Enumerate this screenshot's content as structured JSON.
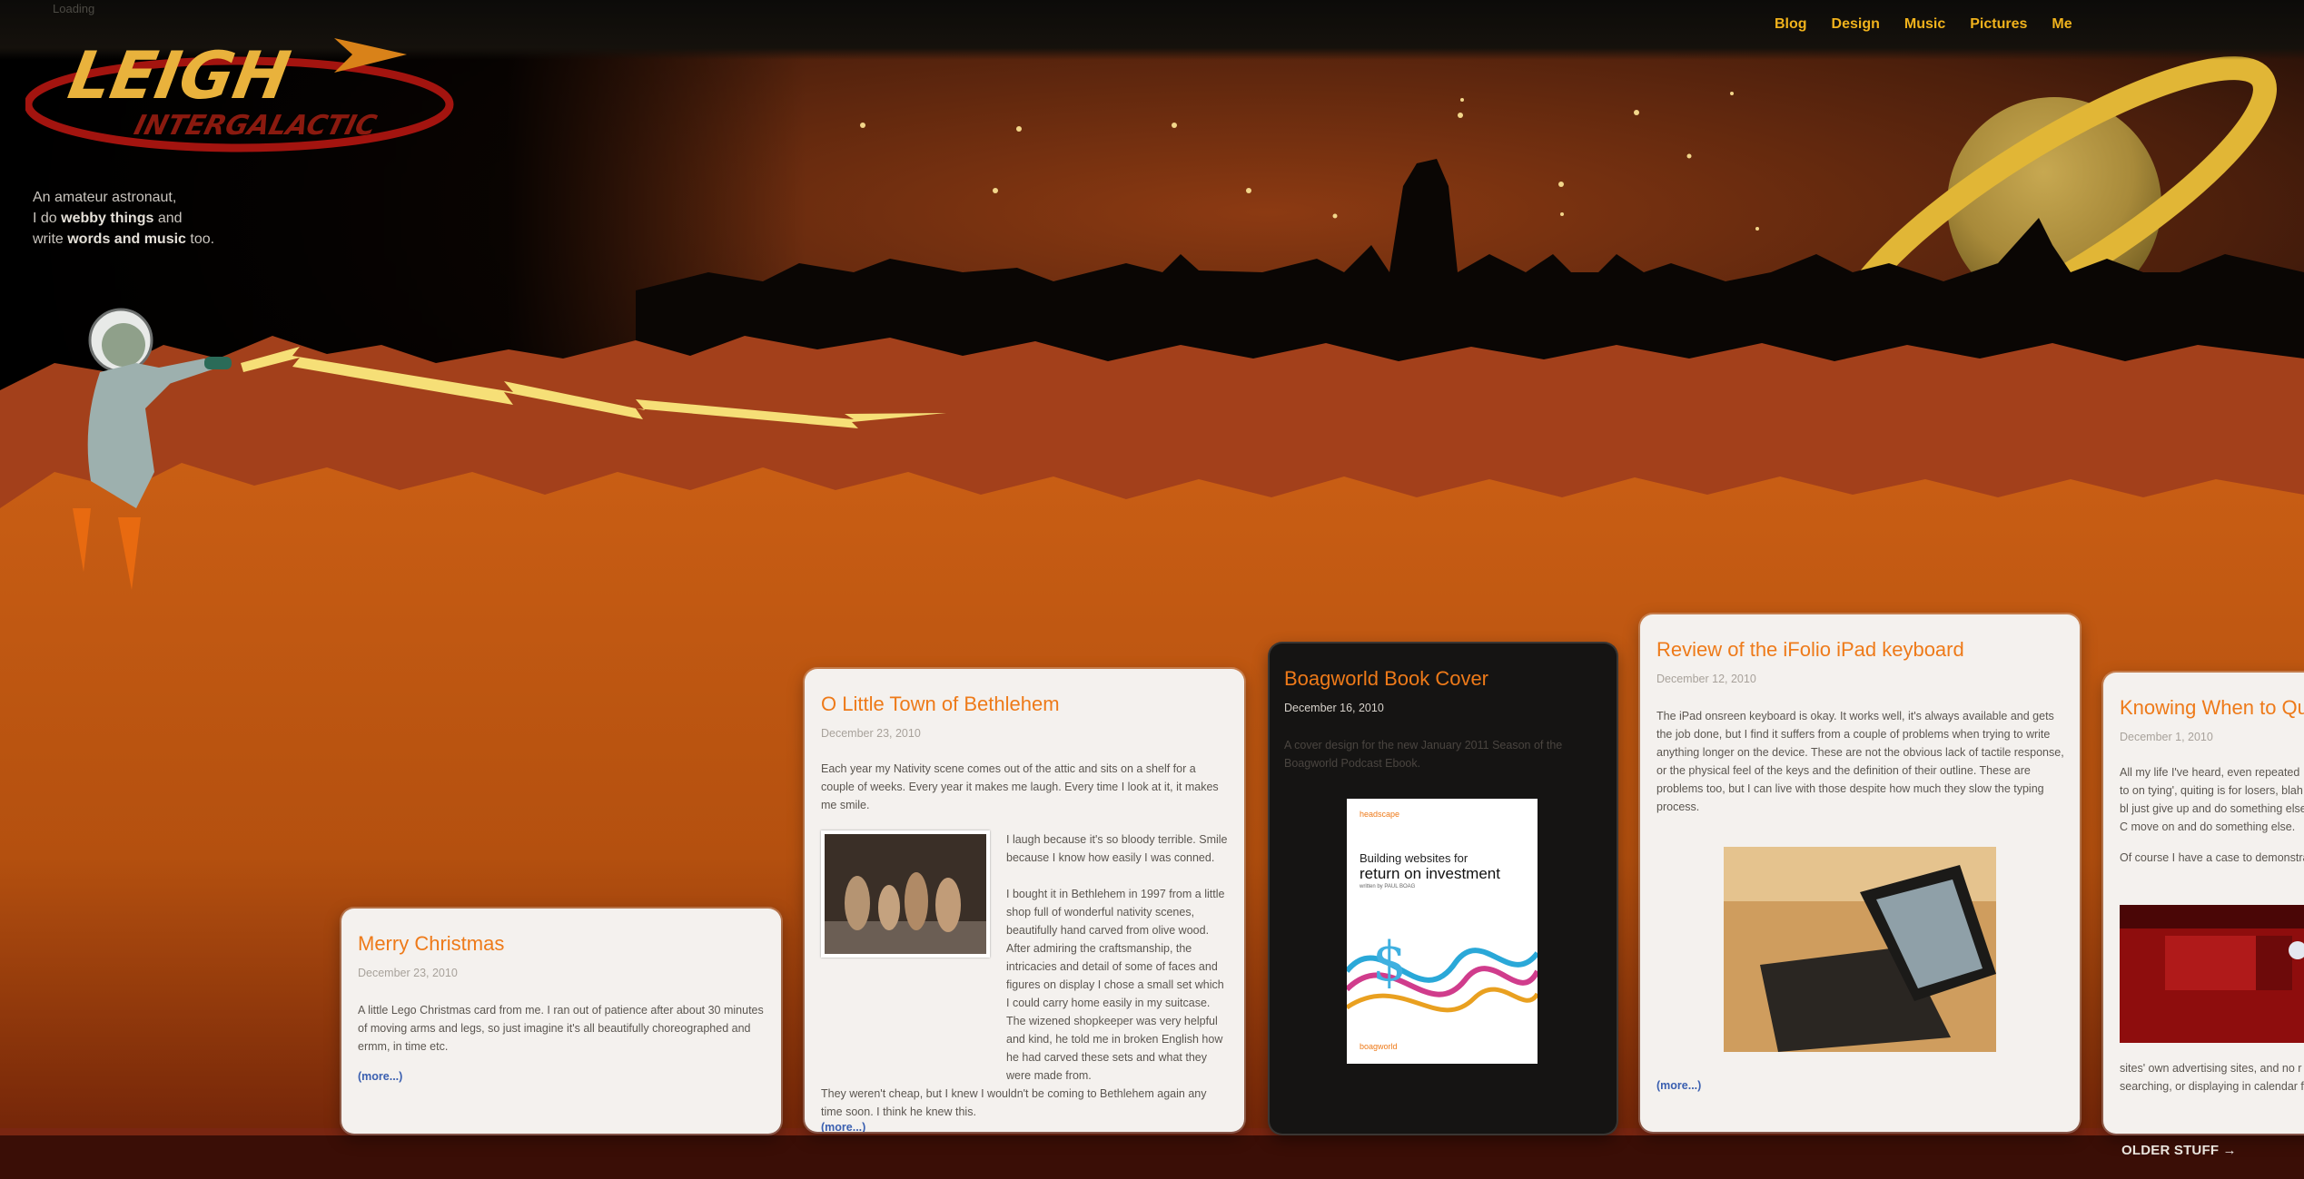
{
  "loading_text": "Loading",
  "logo": {
    "line1": "LEIGH",
    "line2": "INTERGALACTIC"
  },
  "nav": [
    {
      "label": "Blog"
    },
    {
      "label": "Design"
    },
    {
      "label": "Music"
    },
    {
      "label": "Pictures"
    },
    {
      "label": "Me"
    }
  ],
  "tagline": {
    "l1": "An amateur astronaut,",
    "l2_pre": "I do ",
    "l2_bold": "webby things",
    "l2_post": " and",
    "l3_pre": "write ",
    "l3_bold": "words and music",
    "l3_post": " too."
  },
  "posts": [
    {
      "title": "Merry Christmas",
      "date": "December 23, 2010",
      "text": "A little Lego Christmas card from me.  I ran out of patience after about 30 minutes of moving arms and legs, so just imagine it's all beautifully choreographed and ermm, in time etc.",
      "more": "(more...)"
    },
    {
      "title": "O Little Town of Bethlehem",
      "date": "December 23, 2010",
      "p1": "Each year my Nativity scene comes out of the attic and sits on a shelf for a couple of weeks. Every year it makes me laugh. Every time I look at it, it makes me smile.",
      "p2": "I laugh because it's so bloody terrible. Smile because I know how easily I was conned.",
      "p3": "I bought it in Bethlehem in 1997 from a little shop full of wonderful nativity scenes, beautifully hand carved from olive wood. After admiring the craftsmanship, the intricacies and detail of some of faces and figures on display I chose a small set which I could carry home easily in my suitcase. The wizened shopkeeper was very helpful and kind, he told me in broken English how he had carved these sets and what they were made from.",
      "p4": "They weren't cheap, but I knew I wouldn't be coming to Bethlehem again any time soon. I think he knew this.",
      "more": "(more...)"
    },
    {
      "title": "Boagworld Book Cover",
      "date": "December 16, 2010",
      "text": "A cover design for the new January 2011 Season of the Boagworld Podcast Ebook.",
      "book": {
        "brand_top": "headscape",
        "title_line1": "Building websites for",
        "title_line2": "return on investment",
        "byline": "written by PAUL BOAG",
        "brand_bottom": "boagworld"
      }
    },
    {
      "title": "Review of the iFolio iPad keyboard",
      "date": "December 12, 2010",
      "text": "The iPad onsreen keyboard is okay. It works well, it's always available and gets the job done, but I find it suffers from a couple of problems when trying to write anything longer on the device. These are not the obvious lack of tactile response, or the physical feel of the keys and the definition of their outline. These are problems too, but I can live with those despite how much they slow the typing process.",
      "more": "(more...)"
    },
    {
      "title": "Knowing When to Qu",
      "date": "December 1, 2010",
      "p1": "All my life I've heard, even repeated to on tying', quiting is for losers, blah bl just give up and do something else. C move on and do something else.",
      "p2": "Of course I have a case to demonstra",
      "p3": "sites' own advertising sites, and no r searching, or displaying in calendar f"
    }
  ],
  "older_stuff": "OLDER STUFF →",
  "colors": {
    "nav": "#f0b21c",
    "title": "#ee7a19",
    "link": "#3a5fb0",
    "sky_orange": "#d06418",
    "mountain_dark": "#0a0604"
  }
}
